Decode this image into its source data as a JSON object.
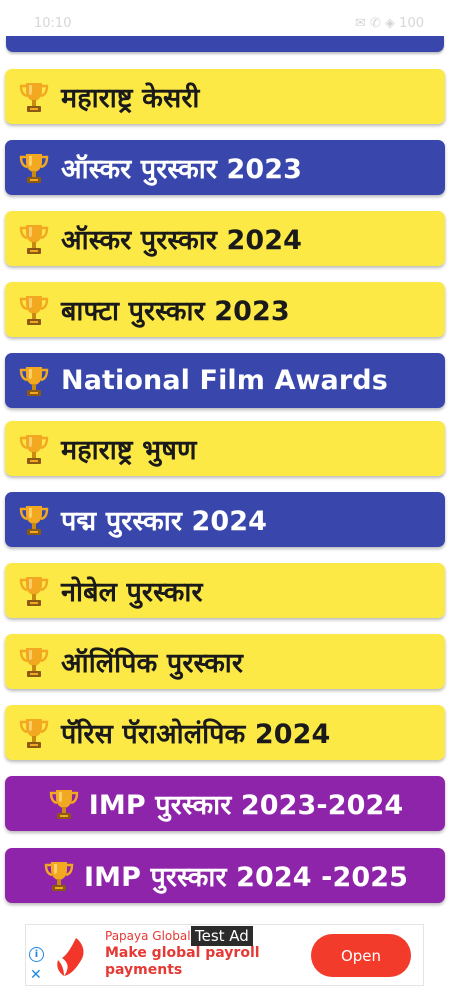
{
  "status_bar": {
    "time": "10:10",
    "indicators": "✉ ✆ ◈ 100"
  },
  "items": [
    {
      "label": "महाराष्ट्र केसरी",
      "color": "yellow"
    },
    {
      "label": "ऑस्कर पुरस्कार 2023",
      "color": "blue"
    },
    {
      "label": "ऑस्कर पुरस्कार 2024",
      "color": "yellow"
    },
    {
      "label": "बाफ्टा पुरस्कार 2023",
      "color": "yellow"
    },
    {
      "label": "National Film Awards",
      "color": "blue"
    },
    {
      "label": "महाराष्ट्र भुषण",
      "color": "yellow"
    },
    {
      "label": "पद्म पुरस्कार 2024",
      "color": "blue"
    },
    {
      "label": "नोबेल पुरस्कार",
      "color": "yellow"
    },
    {
      "label": "ऑलिंपिक पुरस्कार",
      "color": "yellow"
    },
    {
      "label": "पॅरिस पॅराओलंपिक 2024",
      "color": "yellow"
    },
    {
      "label": "IMP पुरस्कार 2023-2024",
      "color": "purple"
    },
    {
      "label": "IMP पुरस्कार 2024 -2025",
      "color": "purple"
    }
  ],
  "colors": {
    "yellow": "#fde946",
    "blue": "#3947ad",
    "purple": "#8e24aa",
    "trophy": "#f2a821"
  },
  "ad": {
    "badge": "Test Ad",
    "brand": "Papaya Global",
    "headline": "Make global payroll payments",
    "cta": "Open",
    "info_icon": "info-icon",
    "close_icon": "close-icon"
  }
}
